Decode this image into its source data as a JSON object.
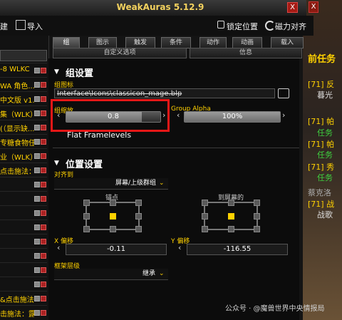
{
  "window": {
    "title": "WeakAuras 5.12.9",
    "close_label": "X"
  },
  "toolbar": {
    "new_label": "建",
    "import_label": "导入",
    "lock_label": "锁定位置",
    "magnet_label": "磁力对齐"
  },
  "left_list": {
    "items": [
      "-8 WLKC",
      "WA 角色...",
      "中文版 v1...",
      "集（WLK）",
      "(（显示缺...",
      "专糖食物任...",
      "业（WLK）...",
      "点击施法：...",
      "",
      "",
      "",
      "",
      "&点击施法...",
      "击施法：露..."
    ]
  },
  "tabs": {
    "row1": [
      "组",
      "图示",
      "触发",
      "条件",
      "动作",
      "动画",
      "载入"
    ],
    "row2": [
      "自定义选项",
      "信息"
    ]
  },
  "group_settings": {
    "title": "组设置",
    "icon_label": "组图标",
    "icon_value": "Interface\\Icons\\classicon_mage.blp",
    "scale_label": "组缩放",
    "scale_value": "0.8",
    "scale_fraction": 0.8,
    "alpha_label": "Group Alpha",
    "alpha_value": "100%",
    "alpha_fraction": 1.0,
    "flat_framelevels": "Flat Framelevels"
  },
  "position_settings": {
    "title": "位置设置",
    "align_label": "对齐到",
    "align_value": "屏幕/上级群组",
    "anchor_label": "锚点",
    "to_screen_label": "到屏幕的",
    "x_label": "X 偏移",
    "x_value": "-0.11",
    "y_label": "Y 偏移",
    "y_value": "-116.55",
    "strata_label": "框架层级",
    "strata_value": "继承"
  },
  "background_quests": {
    "header": "前任务",
    "lines": [
      "[71] 反",
      "暮光",
      "[71] 帕",
      "任务",
      "[71] 帕",
      "任务",
      "[71] 秀",
      "任务",
      "蔡克洛",
      "[71] 战",
      "战歌"
    ]
  },
  "watermark": "公众号 · @魔兽世界中央情报局",
  "colors": {
    "accent": "#ffd100",
    "highlight": "#e81717",
    "title": "#f4d25e"
  }
}
